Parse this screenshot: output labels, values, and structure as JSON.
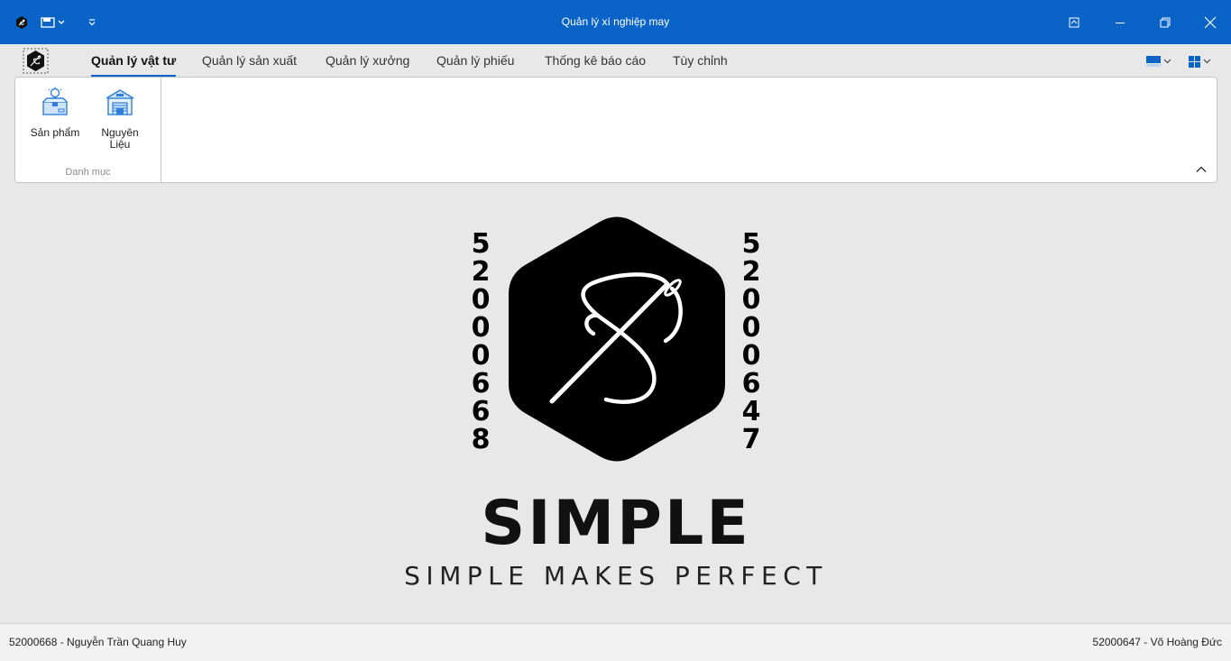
{
  "window": {
    "title": "Quản lý xí nghiệp may",
    "accent_color": "#0a63c7",
    "quick_access_icons": [
      "app-icon",
      "save-icon",
      "chevron-down-icon",
      "customize-quick-access-icon"
    ],
    "controls": [
      "ribbon-display-options-icon",
      "minimize-icon",
      "restore-icon",
      "close-icon"
    ]
  },
  "ribbon": {
    "tabs": [
      {
        "label": "Quản lý vật tư",
        "active": true
      },
      {
        "label": "Quản lý sản xuất",
        "active": false
      },
      {
        "label": "Quản lý xưởng",
        "active": false
      },
      {
        "label": "Quản lý phiếu",
        "active": false
      },
      {
        "label": "Thống kê báo cáo",
        "active": false
      },
      {
        "label": "Tùy chỉnh",
        "active": false
      }
    ],
    "right_tools": [
      "color-theme-icon",
      "layout-icon"
    ],
    "groups": [
      {
        "label": "Danh mục",
        "buttons": [
          {
            "label": "Sản phẩm",
            "icon": "product-box-icon"
          },
          {
            "label_line1": "Nguyên",
            "label_line2": "Liệu",
            "icon": "warehouse-icon"
          }
        ]
      }
    ]
  },
  "main": {
    "logo": {
      "left_digits": [
        "5",
        "2",
        "0",
        "0",
        "0",
        "6",
        "6",
        "8"
      ],
      "right_digits": [
        "5",
        "2",
        "0",
        "0",
        "0",
        "6",
        "4",
        "7"
      ],
      "wordmark": "SIMPLE",
      "tagline": "SIMPLE MAKES PERFECT",
      "emblem": "needle-thread-icon"
    }
  },
  "status": {
    "left": "52000668 - Nguyễn Trần Quang Huy",
    "right": "52000647 - Võ Hoàng Đức"
  }
}
